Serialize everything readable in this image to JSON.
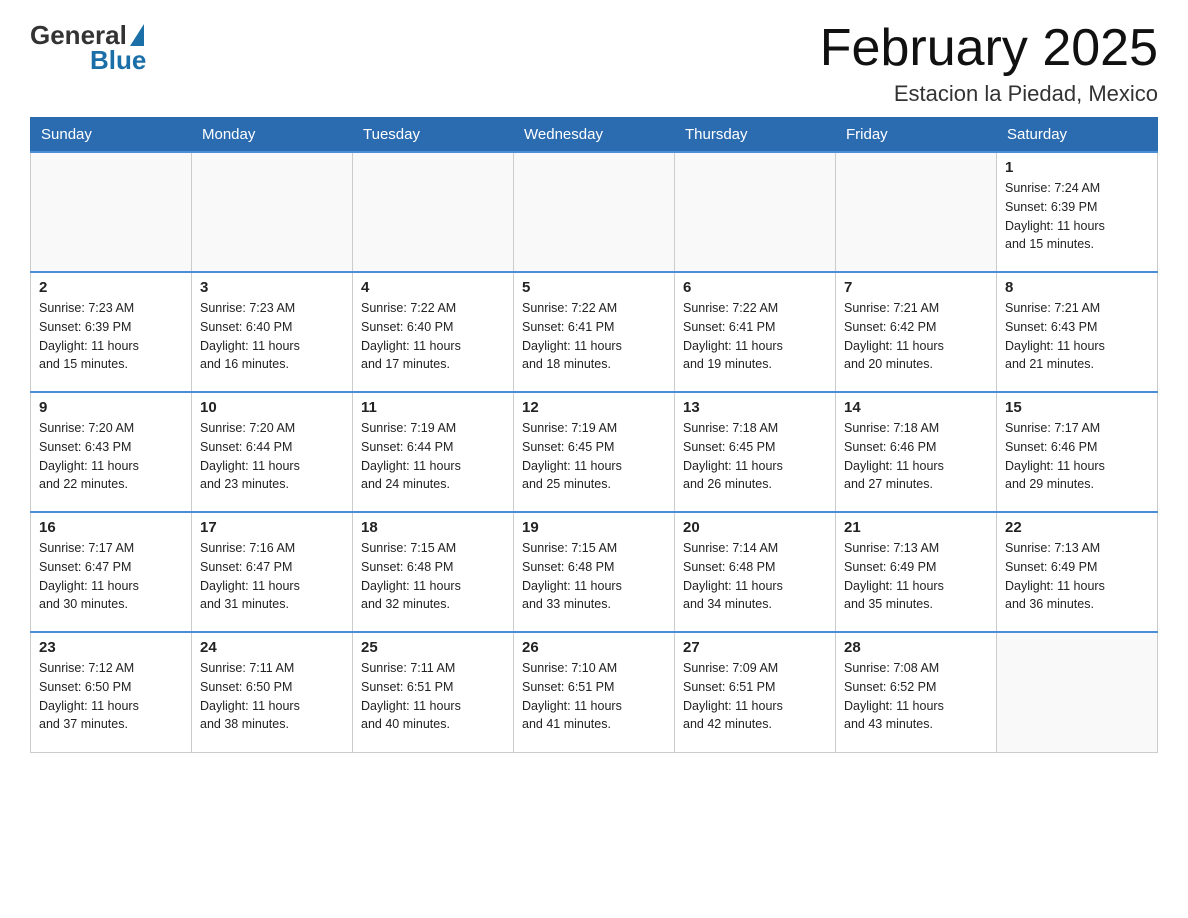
{
  "header": {
    "logo_general": "General",
    "logo_blue": "Blue",
    "month_title": "February 2025",
    "location": "Estacion la Piedad, Mexico"
  },
  "weekdays": [
    "Sunday",
    "Monday",
    "Tuesday",
    "Wednesday",
    "Thursday",
    "Friday",
    "Saturday"
  ],
  "weeks": [
    [
      {
        "day": "",
        "info": ""
      },
      {
        "day": "",
        "info": ""
      },
      {
        "day": "",
        "info": ""
      },
      {
        "day": "",
        "info": ""
      },
      {
        "day": "",
        "info": ""
      },
      {
        "day": "",
        "info": ""
      },
      {
        "day": "1",
        "info": "Sunrise: 7:24 AM\nSunset: 6:39 PM\nDaylight: 11 hours\nand 15 minutes."
      }
    ],
    [
      {
        "day": "2",
        "info": "Sunrise: 7:23 AM\nSunset: 6:39 PM\nDaylight: 11 hours\nand 15 minutes."
      },
      {
        "day": "3",
        "info": "Sunrise: 7:23 AM\nSunset: 6:40 PM\nDaylight: 11 hours\nand 16 minutes."
      },
      {
        "day": "4",
        "info": "Sunrise: 7:22 AM\nSunset: 6:40 PM\nDaylight: 11 hours\nand 17 minutes."
      },
      {
        "day": "5",
        "info": "Sunrise: 7:22 AM\nSunset: 6:41 PM\nDaylight: 11 hours\nand 18 minutes."
      },
      {
        "day": "6",
        "info": "Sunrise: 7:22 AM\nSunset: 6:41 PM\nDaylight: 11 hours\nand 19 minutes."
      },
      {
        "day": "7",
        "info": "Sunrise: 7:21 AM\nSunset: 6:42 PM\nDaylight: 11 hours\nand 20 minutes."
      },
      {
        "day": "8",
        "info": "Sunrise: 7:21 AM\nSunset: 6:43 PM\nDaylight: 11 hours\nand 21 minutes."
      }
    ],
    [
      {
        "day": "9",
        "info": "Sunrise: 7:20 AM\nSunset: 6:43 PM\nDaylight: 11 hours\nand 22 minutes."
      },
      {
        "day": "10",
        "info": "Sunrise: 7:20 AM\nSunset: 6:44 PM\nDaylight: 11 hours\nand 23 minutes."
      },
      {
        "day": "11",
        "info": "Sunrise: 7:19 AM\nSunset: 6:44 PM\nDaylight: 11 hours\nand 24 minutes."
      },
      {
        "day": "12",
        "info": "Sunrise: 7:19 AM\nSunset: 6:45 PM\nDaylight: 11 hours\nand 25 minutes."
      },
      {
        "day": "13",
        "info": "Sunrise: 7:18 AM\nSunset: 6:45 PM\nDaylight: 11 hours\nand 26 minutes."
      },
      {
        "day": "14",
        "info": "Sunrise: 7:18 AM\nSunset: 6:46 PM\nDaylight: 11 hours\nand 27 minutes."
      },
      {
        "day": "15",
        "info": "Sunrise: 7:17 AM\nSunset: 6:46 PM\nDaylight: 11 hours\nand 29 minutes."
      }
    ],
    [
      {
        "day": "16",
        "info": "Sunrise: 7:17 AM\nSunset: 6:47 PM\nDaylight: 11 hours\nand 30 minutes."
      },
      {
        "day": "17",
        "info": "Sunrise: 7:16 AM\nSunset: 6:47 PM\nDaylight: 11 hours\nand 31 minutes."
      },
      {
        "day": "18",
        "info": "Sunrise: 7:15 AM\nSunset: 6:48 PM\nDaylight: 11 hours\nand 32 minutes."
      },
      {
        "day": "19",
        "info": "Sunrise: 7:15 AM\nSunset: 6:48 PM\nDaylight: 11 hours\nand 33 minutes."
      },
      {
        "day": "20",
        "info": "Sunrise: 7:14 AM\nSunset: 6:48 PM\nDaylight: 11 hours\nand 34 minutes."
      },
      {
        "day": "21",
        "info": "Sunrise: 7:13 AM\nSunset: 6:49 PM\nDaylight: 11 hours\nand 35 minutes."
      },
      {
        "day": "22",
        "info": "Sunrise: 7:13 AM\nSunset: 6:49 PM\nDaylight: 11 hours\nand 36 minutes."
      }
    ],
    [
      {
        "day": "23",
        "info": "Sunrise: 7:12 AM\nSunset: 6:50 PM\nDaylight: 11 hours\nand 37 minutes."
      },
      {
        "day": "24",
        "info": "Sunrise: 7:11 AM\nSunset: 6:50 PM\nDaylight: 11 hours\nand 38 minutes."
      },
      {
        "day": "25",
        "info": "Sunrise: 7:11 AM\nSunset: 6:51 PM\nDaylight: 11 hours\nand 40 minutes."
      },
      {
        "day": "26",
        "info": "Sunrise: 7:10 AM\nSunset: 6:51 PM\nDaylight: 11 hours\nand 41 minutes."
      },
      {
        "day": "27",
        "info": "Sunrise: 7:09 AM\nSunset: 6:51 PM\nDaylight: 11 hours\nand 42 minutes."
      },
      {
        "day": "28",
        "info": "Sunrise: 7:08 AM\nSunset: 6:52 PM\nDaylight: 11 hours\nand 43 minutes."
      },
      {
        "day": "",
        "info": ""
      }
    ]
  ]
}
